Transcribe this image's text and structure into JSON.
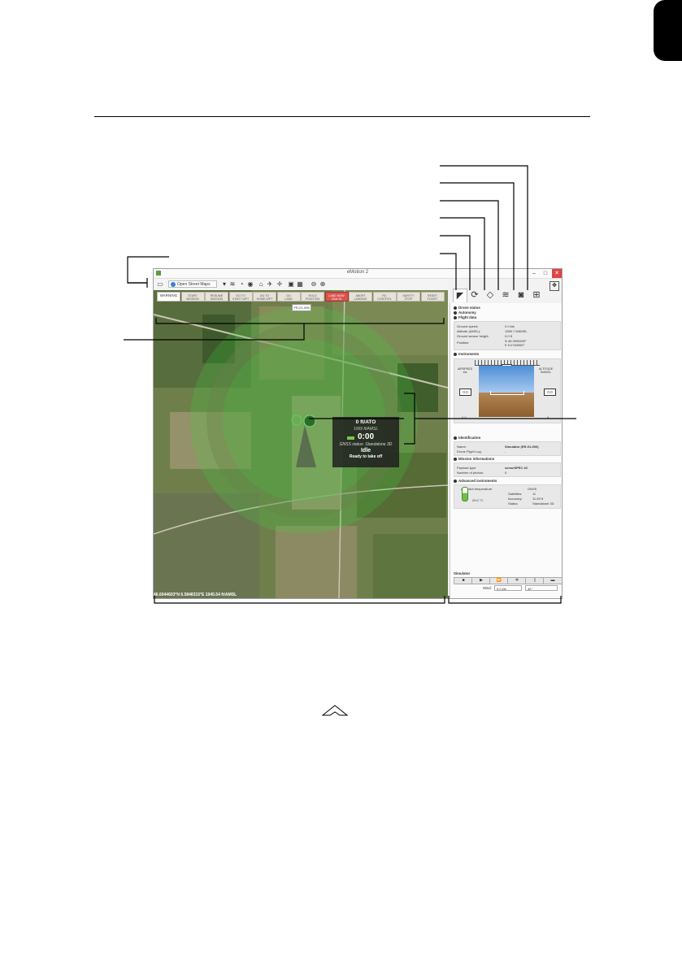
{
  "window": {
    "title": "eMotion 2",
    "controls": [
      "–",
      "□",
      "✕"
    ]
  },
  "toolbar": {
    "map_source": "Open Street Maps",
    "icons": [
      "flight-plan-icon",
      "layers-icon",
      "elevation-icon",
      "weather-icon",
      "globe-icon",
      "home-icon",
      "drone-icon",
      "waypoint-icon",
      "draw-polygon-icon",
      "draw-area-icon",
      "zoom-out-icon",
      "zoom-in-icon"
    ]
  },
  "commands": [
    {
      "label": "WARNING",
      "state": "active"
    },
    {
      "label": "START\nMISSION",
      "state": "normal"
    },
    {
      "label": "RESUME\nMISSION",
      "state": "normal"
    },
    {
      "label": "GO TO\nSTART WPT",
      "state": "normal"
    },
    {
      "label": "GO TO\nHOME WPT",
      "state": "normal"
    },
    {
      "label": "GO\nLAND",
      "state": "normal"
    },
    {
      "label": "HOLD\nPOSITION",
      "state": "normal"
    },
    {
      "label": "LAND NOW\nClick 3x",
      "state": "alert"
    },
    {
      "label": "ABORT\nLANDING",
      "state": "normal"
    },
    {
      "label": "RC\nCONTROL",
      "state": "normal"
    },
    {
      "label": "SAFETY\nSTOP",
      "state": "normal"
    },
    {
      "label": "RESET\nFLIGHT",
      "state": "normal"
    }
  ],
  "map": {
    "gps_badge": "FR-01-008",
    "coordinates": "46.6044603°N 6.5848315°E 1945.54 ft/AMSL",
    "status": {
      "altitude": "0 ft/ATO",
      "amsl": "1069 ft/AMSL",
      "timer": "0:00",
      "gnss": "GNSS status: Standalone 3D",
      "state": "Idle",
      "message": "Ready to take off"
    }
  },
  "panel": {
    "tabs": [
      "drone-tab-icon",
      "sync-tab-icon",
      "mission-tab-icon",
      "layers-tab-icon",
      "camera-tab-icon",
      "settings-tab-icon"
    ],
    "sections": {
      "drone_status": "Drone status",
      "autonomy": "Autonomy",
      "flight_data": "Flight data",
      "instruments": "Instruments",
      "identification": "Identification",
      "mission_information": "Mission informations",
      "advanced_instruments": "Advanced instruments"
    },
    "flight_data": [
      {
        "key": "Ground speed:",
        "value": "0.0 kts"
      },
      {
        "key": "Altitude (AMSL):",
        "value": "1069.7 ft/AMSL"
      },
      {
        "key": "Ground sensor height:",
        "value": "0.0 ft"
      },
      {
        "key": "Position:",
        "value": "N 46.3905409°\nE 6.0754550°"
      }
    ],
    "instruments": {
      "airspeed_label": "AIRSPEED\nkts",
      "altitude_label": "ALTITUDE\nft/AMSL",
      "airspeed": "0.0",
      "altitude": "0.0",
      "heading": "299",
      "airspeed_bottom": "0.0",
      "altitude_bottom": "0"
    },
    "identification": [
      {
        "key": "Name:",
        "value": "Simulator (ER-01-000)"
      },
      {
        "key": "Drone Flight Log:",
        "value": "-"
      }
    ],
    "mission": [
      {
        "key": "Payload type:",
        "value": "senseSPEC 4C"
      },
      {
        "key": "Number of photos:",
        "value": "0"
      }
    ],
    "advanced": {
      "temp_label": "Autopilot temperature",
      "temp_value": "29.0 °C",
      "gnss_label": "GNSS",
      "rows": [
        {
          "key": "Satellites:",
          "value": "11"
        },
        {
          "key": "Accuracy:",
          "value": "11.59 ft"
        },
        {
          "key": "Status:",
          "value": "Standalone 3D"
        }
      ]
    },
    "simulator": {
      "title": "Simulator",
      "buttons": [
        "■",
        "▶",
        "⏩",
        "✲",
        "▯",
        "▬"
      ],
      "wind_label": "Wind:",
      "wind_speed": "0.0 kts",
      "wind_dir": "45 °"
    }
  }
}
